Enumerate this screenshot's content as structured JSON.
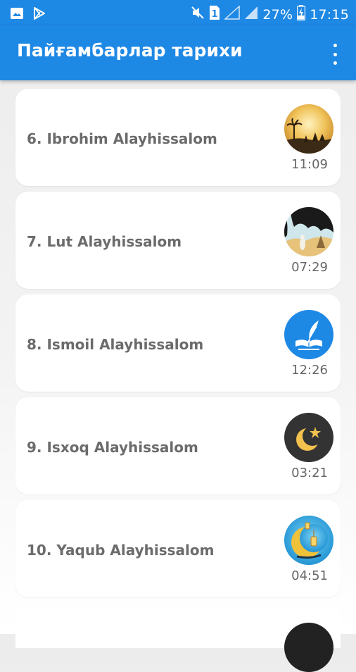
{
  "statusbar": {
    "battery_percent": "27%",
    "time": "17:15",
    "sim_slot": "1"
  },
  "appbar": {
    "title": "Пайғамбарлар тарихи",
    "menu_icon": "more-vert-icon"
  },
  "items": [
    {
      "title": "6. Ibrohim Alayhissalom",
      "duration": "11:09",
      "thumb_icon": "desert-sunset-icon"
    },
    {
      "title": "7. Lut Alayhissalom",
      "duration": "07:29",
      "thumb_icon": "cave-scene-icon"
    },
    {
      "title": "8. Ismoil Alayhissalom",
      "duration": "12:26",
      "thumb_icon": "book-quill-icon"
    },
    {
      "title": "9. Isxoq Alayhissalom",
      "duration": "03:21",
      "thumb_icon": "crescent-star-icon"
    },
    {
      "title": "10. Yaqub Alayhissalom",
      "duration": "04:51",
      "thumb_icon": "crescent-lantern-icon"
    }
  ],
  "colors": {
    "primary": "#1e88e5",
    "card_title": "#6b6b6b",
    "duration": "#666666"
  }
}
